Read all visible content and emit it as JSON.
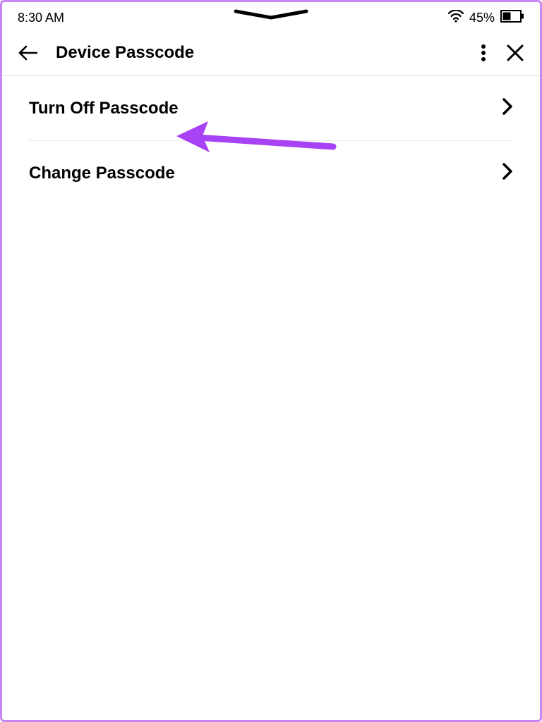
{
  "status": {
    "time": "8:30 AM",
    "battery": "45%"
  },
  "header": {
    "title": "Device Passcode"
  },
  "rows": [
    {
      "label": "Turn Off Passcode"
    },
    {
      "label": "Change Passcode"
    }
  ],
  "colors": {
    "annotation": "#a742f5",
    "border": "#c987f5"
  }
}
